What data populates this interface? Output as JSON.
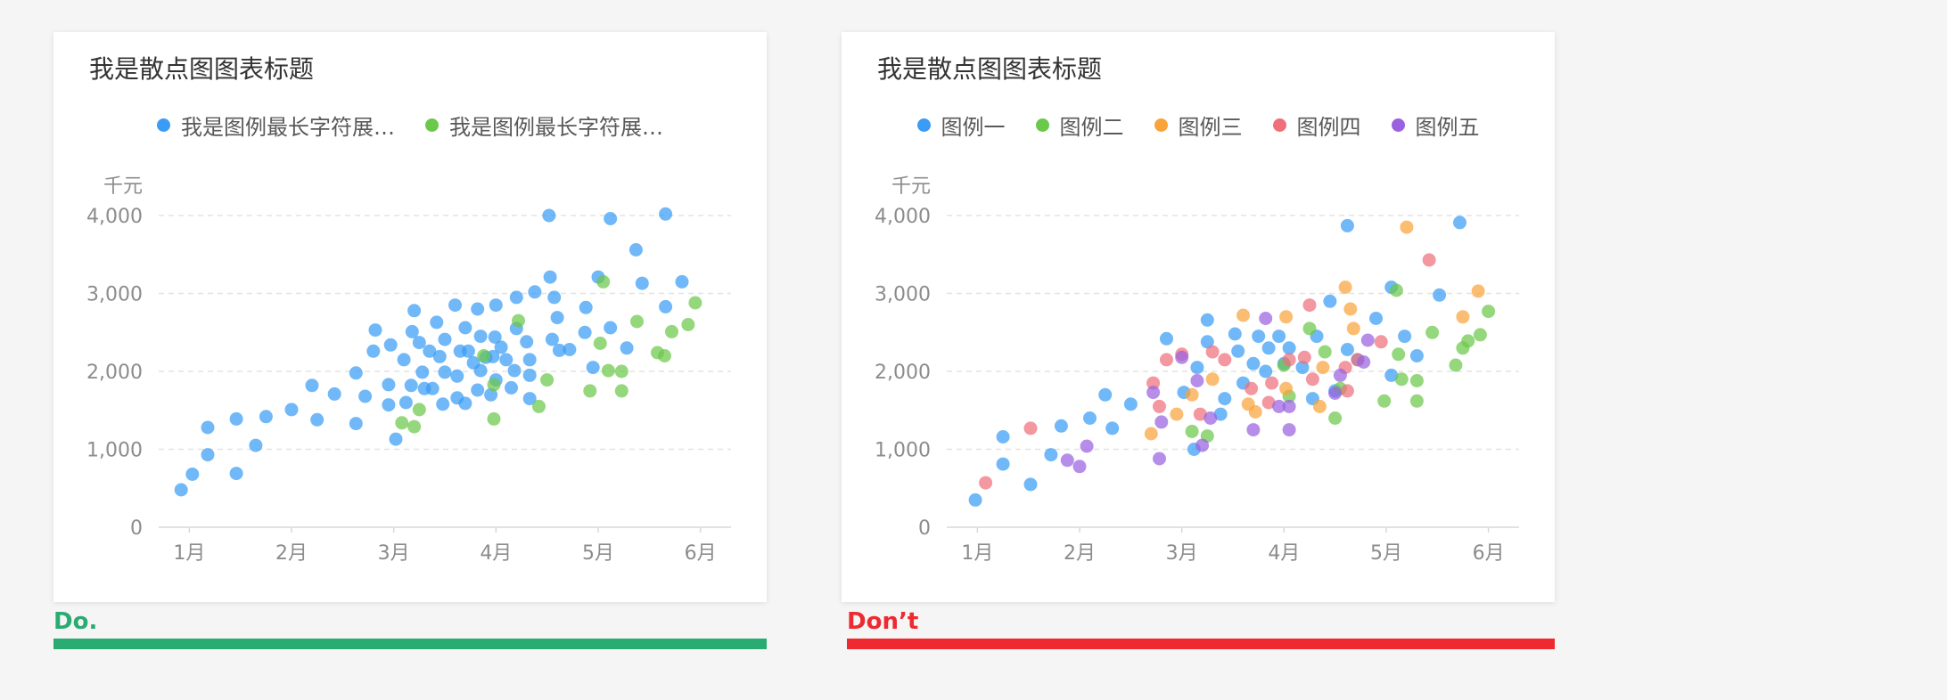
{
  "chart_data": [
    {
      "type": "scatter",
      "title": "我是散点图图表标题",
      "ylabel": "千元",
      "x_ticks": [
        "1月",
        "2月",
        "3月",
        "4月",
        "5月",
        "6月"
      ],
      "y_ticks": [
        "0",
        "1,000",
        "2,000",
        "3,000",
        "4,000"
      ],
      "ylim": [
        0,
        4000
      ],
      "grid": true,
      "legend_position": "top-center",
      "series": [
        {
          "name": "我是图例最长字符展…",
          "color": "#3a9cf5",
          "points": [
            [
              0.92,
              480
            ],
            [
              1.03,
              680
            ],
            [
              1.18,
              1280
            ],
            [
              1.18,
              930
            ],
            [
              1.46,
              1390
            ],
            [
              1.46,
              690
            ],
            [
              1.65,
              1050
            ],
            [
              1.75,
              1420
            ],
            [
              2.0,
              1510
            ],
            [
              2.2,
              1820
            ],
            [
              2.25,
              1380
            ],
            [
              2.42,
              1710
            ],
            [
              2.63,
              1980
            ],
            [
              2.63,
              1330
            ],
            [
              2.72,
              1680
            ],
            [
              2.8,
              2260
            ],
            [
              2.82,
              2530
            ],
            [
              2.97,
              2340
            ],
            [
              2.95,
              1570
            ],
            [
              2.95,
              1830
            ],
            [
              3.02,
              1130
            ],
            [
              3.1,
              2150
            ],
            [
              3.12,
              1600
            ],
            [
              3.17,
              1820
            ],
            [
              3.18,
              2510
            ],
            [
              3.2,
              2780
            ],
            [
              3.25,
              2370
            ],
            [
              3.28,
              1990
            ],
            [
              3.3,
              1780
            ],
            [
              3.35,
              2260
            ],
            [
              3.38,
              1780
            ],
            [
              3.42,
              2630
            ],
            [
              3.45,
              2190
            ],
            [
              3.48,
              1580
            ],
            [
              3.5,
              2410
            ],
            [
              3.5,
              1990
            ],
            [
              3.6,
              2850
            ],
            [
              3.62,
              1940
            ],
            [
              3.62,
              1660
            ],
            [
              3.65,
              2260
            ],
            [
              3.7,
              2560
            ],
            [
              3.7,
              1590
            ],
            [
              3.73,
              2260
            ],
            [
              3.78,
              2110
            ],
            [
              3.82,
              2800
            ],
            [
              3.82,
              1760
            ],
            [
              3.85,
              2450
            ],
            [
              3.85,
              2010
            ],
            [
              3.9,
              2180
            ],
            [
              3.95,
              1700
            ],
            [
              3.97,
              2190
            ],
            [
              3.99,
              2440
            ],
            [
              4.0,
              2850
            ],
            [
              4.0,
              1890
            ],
            [
              4.05,
              2310
            ],
            [
              4.1,
              2150
            ],
            [
              4.15,
              1790
            ],
            [
              4.18,
              2010
            ],
            [
              4.2,
              2550
            ],
            [
              4.2,
              2950
            ],
            [
              4.3,
              2380
            ],
            [
              4.33,
              2150
            ],
            [
              4.33,
              1950
            ],
            [
              4.33,
              1650
            ],
            [
              4.38,
              3020
            ],
            [
              4.52,
              4000
            ],
            [
              4.53,
              3210
            ],
            [
              4.55,
              2410
            ],
            [
              4.57,
              2950
            ],
            [
              4.6,
              2690
            ],
            [
              4.62,
              2270
            ],
            [
              4.72,
              2280
            ],
            [
              4.87,
              2500
            ],
            [
              4.88,
              2820
            ],
            [
              4.95,
              2050
            ],
            [
              5.0,
              3210
            ],
            [
              5.12,
              2560
            ],
            [
              5.12,
              3960
            ],
            [
              5.28,
              2300
            ],
            [
              5.37,
              3560
            ],
            [
              5.43,
              3130
            ],
            [
              5.66,
              2830
            ],
            [
              5.66,
              4020
            ],
            [
              5.82,
              3150
            ]
          ]
        },
        {
          "name": "我是图例最长字符展…",
          "color": "#6cc84a",
          "points": [
            [
              3.08,
              1340
            ],
            [
              3.2,
              1290
            ],
            [
              3.25,
              1510
            ],
            [
              3.88,
              2200
            ],
            [
              3.98,
              1390
            ],
            [
              3.98,
              1830
            ],
            [
              4.22,
              2650
            ],
            [
              4.42,
              1550
            ],
            [
              4.5,
              1890
            ],
            [
              4.92,
              1750
            ],
            [
              5.02,
              2360
            ],
            [
              5.05,
              3150
            ],
            [
              5.1,
              2010
            ],
            [
              5.23,
              1750
            ],
            [
              5.23,
              2000
            ],
            [
              5.38,
              2640
            ],
            [
              5.58,
              2240
            ],
            [
              5.65,
              2200
            ],
            [
              5.72,
              2510
            ],
            [
              5.88,
              2600
            ],
            [
              5.95,
              2880
            ]
          ]
        }
      ]
    },
    {
      "type": "scatter",
      "title": "我是散点图图表标题",
      "ylabel": "千元",
      "x_ticks": [
        "1月",
        "2月",
        "3月",
        "4月",
        "5月",
        "6月"
      ],
      "y_ticks": [
        "0",
        "1,000",
        "2,000",
        "3,000",
        "4,000"
      ],
      "ylim": [
        0,
        4000
      ],
      "grid": true,
      "legend_position": "top-center",
      "series": [
        {
          "name": "图例一",
          "color": "#3a9cf5",
          "points": [
            [
              0.98,
              350
            ],
            [
              1.25,
              810
            ],
            [
              1.25,
              1160
            ],
            [
              1.52,
              550
            ],
            [
              1.72,
              930
            ],
            [
              1.82,
              1300
            ],
            [
              2.1,
              1400
            ],
            [
              2.25,
              1700
            ],
            [
              2.32,
              1270
            ],
            [
              2.5,
              1580
            ],
            [
              2.85,
              2420
            ],
            [
              3.02,
              1730
            ],
            [
              3.12,
              1000
            ],
            [
              3.15,
              2050
            ],
            [
              3.25,
              2380
            ],
            [
              3.25,
              2660
            ],
            [
              3.38,
              1450
            ],
            [
              3.42,
              1650
            ],
            [
              3.52,
              2480
            ],
            [
              3.55,
              2260
            ],
            [
              3.6,
              1850
            ],
            [
              3.7,
              2100
            ],
            [
              3.75,
              2450
            ],
            [
              3.82,
              2000
            ],
            [
              3.85,
              2300
            ],
            [
              3.95,
              2450
            ],
            [
              4.0,
              2100
            ],
            [
              4.05,
              2300
            ],
            [
              4.18,
              2050
            ],
            [
              4.28,
              1650
            ],
            [
              4.32,
              2450
            ],
            [
              4.45,
              2900
            ],
            [
              4.5,
              1750
            ],
            [
              4.62,
              3870
            ],
            [
              4.62,
              2280
            ],
            [
              4.72,
              2150
            ],
            [
              4.9,
              2680
            ],
            [
              5.05,
              1950
            ],
            [
              5.05,
              3080
            ],
            [
              5.18,
              2450
            ],
            [
              5.3,
              2200
            ],
            [
              5.52,
              2980
            ],
            [
              5.72,
              3910
            ]
          ]
        },
        {
          "name": "图例二",
          "color": "#6cc84a",
          "points": [
            [
              3.1,
              1230
            ],
            [
              3.25,
              1170
            ],
            [
              4.0,
              2080
            ],
            [
              4.05,
              1680
            ],
            [
              4.25,
              2550
            ],
            [
              4.4,
              2250
            ],
            [
              4.5,
              1400
            ],
            [
              4.55,
              1780
            ],
            [
              4.98,
              1620
            ],
            [
              5.1,
              3040
            ],
            [
              5.12,
              2220
            ],
            [
              5.15,
              1900
            ],
            [
              5.3,
              1620
            ],
            [
              5.3,
              1880
            ],
            [
              5.45,
              2500
            ],
            [
              5.68,
              2080
            ],
            [
              5.75,
              2300
            ],
            [
              5.8,
              2390
            ],
            [
              5.92,
              2470
            ],
            [
              6.0,
              2770
            ]
          ]
        },
        {
          "name": "图例三",
          "color": "#f9a33a",
          "points": [
            [
              2.7,
              1200
            ],
            [
              2.95,
              1450
            ],
            [
              3.1,
              1700
            ],
            [
              3.3,
              1900
            ],
            [
              3.6,
              2720
            ],
            [
              3.65,
              1580
            ],
            [
              3.72,
              1480
            ],
            [
              4.02,
              2700
            ],
            [
              4.02,
              1780
            ],
            [
              4.35,
              1550
            ],
            [
              4.38,
              2050
            ],
            [
              4.6,
              3080
            ],
            [
              4.65,
              2800
            ],
            [
              4.68,
              2550
            ],
            [
              5.2,
              3850
            ],
            [
              5.75,
              2700
            ],
            [
              5.9,
              3030
            ]
          ]
        },
        {
          "name": "图例四",
          "color": "#ef6f7c",
          "points": [
            [
              1.08,
              570
            ],
            [
              1.52,
              1270
            ],
            [
              2.72,
              1850
            ],
            [
              2.78,
              1550
            ],
            [
              2.85,
              2150
            ],
            [
              3.0,
              2220
            ],
            [
              3.18,
              1450
            ],
            [
              3.3,
              2250
            ],
            [
              3.42,
              2150
            ],
            [
              3.68,
              1780
            ],
            [
              3.85,
              1600
            ],
            [
              3.88,
              1850
            ],
            [
              4.05,
              2150
            ],
            [
              4.2,
              2180
            ],
            [
              4.25,
              2850
            ],
            [
              4.28,
              1900
            ],
            [
              4.6,
              2050
            ],
            [
              4.62,
              1750
            ],
            [
              4.72,
              2150
            ],
            [
              4.95,
              2380
            ],
            [
              5.42,
              3430
            ]
          ]
        },
        {
          "name": "图例五",
          "color": "#9a62e0",
          "points": [
            [
              1.88,
              860
            ],
            [
              2.0,
              780
            ],
            [
              2.07,
              1040
            ],
            [
              2.72,
              1730
            ],
            [
              2.78,
              880
            ],
            [
              2.8,
              1350
            ],
            [
              3.0,
              2180
            ],
            [
              3.15,
              1880
            ],
            [
              3.2,
              1050
            ],
            [
              3.28,
              1400
            ],
            [
              3.7,
              1250
            ],
            [
              3.82,
              2680
            ],
            [
              3.95,
              1550
            ],
            [
              4.05,
              1550
            ],
            [
              4.05,
              1250
            ],
            [
              4.5,
              1720
            ],
            [
              4.55,
              1950
            ],
            [
              4.78,
              2120
            ],
            [
              4.82,
              2400
            ]
          ]
        }
      ]
    }
  ],
  "verdicts": [
    {
      "label": "Do.",
      "color": "#2aab72"
    },
    {
      "label": "Don’t",
      "color": "#ee2a30"
    }
  ]
}
